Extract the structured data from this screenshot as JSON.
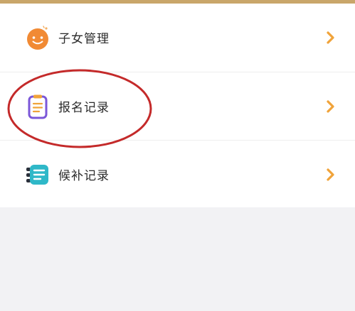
{
  "menu": {
    "items": [
      {
        "label": "子女管理",
        "icon": "smiley-face-icon",
        "chevron": "chevron-right-icon"
      },
      {
        "label": "报名记录",
        "icon": "clipboard-icon",
        "chevron": "chevron-right-icon"
      },
      {
        "label": "候补记录",
        "icon": "list-icon",
        "chevron": "chevron-right-icon"
      }
    ]
  },
  "colors": {
    "accent_orange": "#f0a33a",
    "smiley_orange": "#f18a34",
    "clipboard_purple": "#7b57d8",
    "list_teal": "#2fb8c8",
    "highlight_red": "#c42a2a",
    "top_strip": "#c9a66a"
  }
}
